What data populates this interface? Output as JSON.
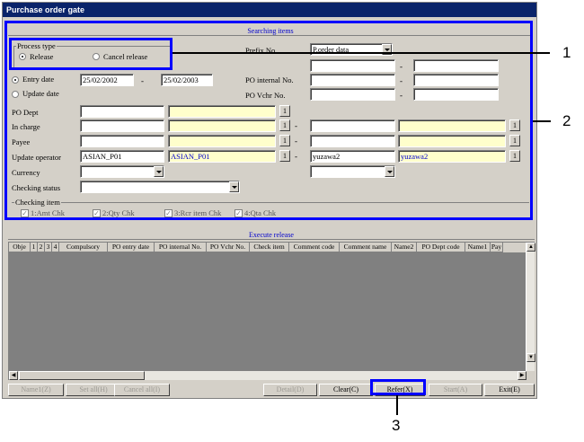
{
  "window": {
    "title": "Purchase order gate"
  },
  "search": {
    "header": "Searching items",
    "process_type": {
      "title": "Process type",
      "release": "Release",
      "cancel_release": "Cancel release",
      "selected": "release"
    },
    "prefix_label": "Prefix No.",
    "prefix_value": "P.order data",
    "entry_date_label": "Entry date",
    "update_date_label": "Update date",
    "entry_date_from": "25/02/2002",
    "entry_date_to": "25/02/2003",
    "po_internal_label": "PO internal No.",
    "po_vchr_label": "PO Vchr No.",
    "po_dept_label": "PO Dept",
    "in_charge_label": "In charge",
    "payee_label": "Payee",
    "update_operator_label": "Update operator",
    "update_operator": {
      "code_from": "ASIAN_P01",
      "name_from": "ASIAN_P01",
      "code_to": "yuzawa2",
      "name_to": "yuzawa2"
    },
    "currency_label": "Currency",
    "checking_status_label": "Checking status",
    "lookup_button": "1",
    "range_dash": "-",
    "checking_item": {
      "title": "Checking item",
      "items": [
        "1:Amt Chk",
        "2:Qty Chk",
        "3:Rcr item Chk",
        "4:Qta Chk"
      ]
    }
  },
  "execute": {
    "header": "Execute release",
    "columns": [
      "Obje",
      "1",
      "2",
      "3",
      "4",
      "Compulsory",
      "PO entry date",
      "PO internal No.",
      "PO Vchr No.",
      "Check item",
      "Comment code",
      "Comment name",
      "Name2",
      "PO Dept code",
      "Name1",
      "Pay"
    ]
  },
  "buttons": {
    "name": "Name1(Z)",
    "set_all": "Set all(H)",
    "cancel_all": "Cancel all(I)",
    "detail": "Detail(D)",
    "clear": "Clear(C)",
    "refer": "Refer(X)",
    "start": "Start(A)",
    "exit": "Exit(E)"
  },
  "callouts": [
    "1",
    "2",
    "3"
  ],
  "colors": {
    "titlebar": "#0a246a",
    "highlight": "#0000ff",
    "readonly_field": "#ffffcc",
    "window": "#d4d0c8"
  }
}
